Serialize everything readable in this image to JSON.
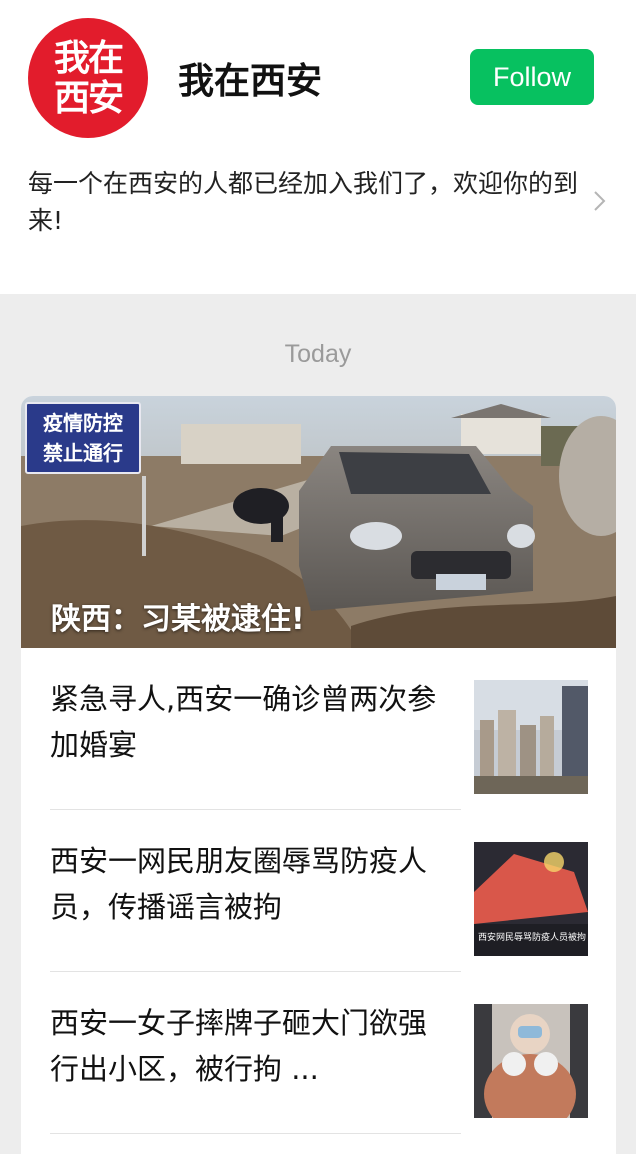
{
  "account": {
    "avatar_text_line1": "我在",
    "avatar_text_line2": "西安",
    "name": "我在西安",
    "follow_label": "Follow",
    "description": "每一个在西安的人都已经加入我们了，欢迎你的到来!",
    "colors": {
      "avatar": "#e21c2c",
      "follow": "#07c160"
    }
  },
  "feed": {
    "date_label": "Today",
    "hero": {
      "sign_line1": "疫情防控",
      "sign_line2": "禁止通行",
      "title": "陕西：习某被逮住!"
    },
    "articles": [
      {
        "title": "紧急寻人,西安一确诊曾两次参加婚宴"
      },
      {
        "title": "西安一网民朋友圈辱骂防疫人员，传播谣言被拘",
        "thumb_caption": "西安网民辱骂防疫人员被拘"
      },
      {
        "title": "西安一女子摔牌子砸大门欲强行出小区，被行拘 ..."
      }
    ]
  }
}
